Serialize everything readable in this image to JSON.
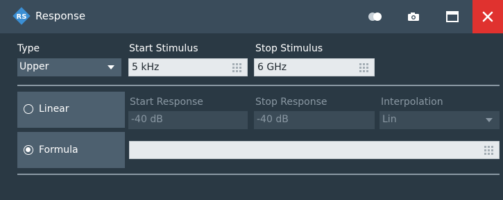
{
  "window": {
    "title": "Response",
    "icons": {
      "logo": "rohde-schwarz-logo",
      "toggle": "toggle-icon",
      "camera": "camera-icon",
      "maximize": "maximize-icon",
      "close": "close-icon"
    },
    "colors": {
      "titlebar": "#3a4c5b",
      "close": "#e0322f",
      "background": "#2a3944"
    }
  },
  "type": {
    "label": "Type",
    "value": "Upper"
  },
  "start_stimulus": {
    "label": "Start Stimulus",
    "value": "5 kHz"
  },
  "stop_stimulus": {
    "label": "Stop Stimulus",
    "value": "6 GHz"
  },
  "linear": {
    "label": "Linear",
    "selected": false
  },
  "formula": {
    "label": "Formula",
    "selected": true,
    "value": ""
  },
  "start_response": {
    "label": "Start Response",
    "value": "-40 dB"
  },
  "stop_response": {
    "label": "Stop Response",
    "value": "-40 dB"
  },
  "interpolation": {
    "label": "Interpolation",
    "value": "Lin"
  }
}
